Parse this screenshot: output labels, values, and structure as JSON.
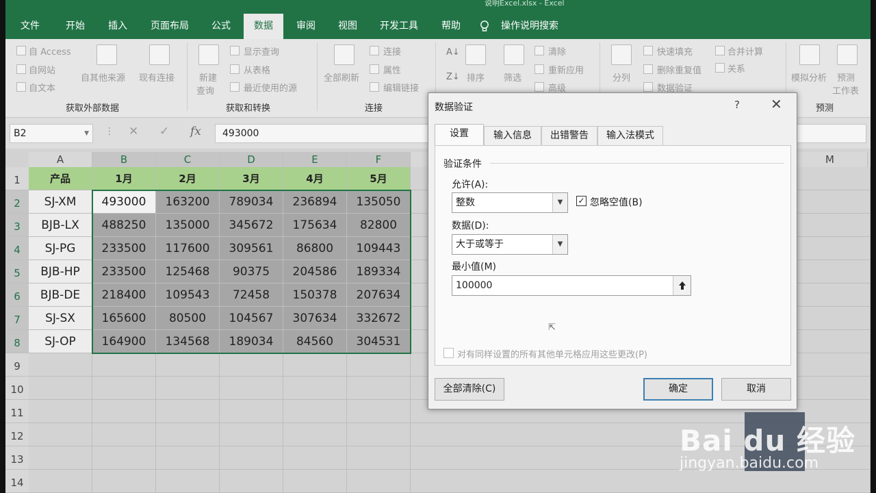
{
  "window_title": "说明Excel.xlsx - Excel",
  "ribbon": {
    "tabs": [
      "文件",
      "开始",
      "插入",
      "页面布局",
      "公式",
      "数据",
      "审阅",
      "视图",
      "开发工具",
      "帮助"
    ],
    "active_tab": "数据",
    "tell_me": "操作说明搜索",
    "groups": {
      "get_external": {
        "label": "获取外部数据",
        "items": [
          "自 Access",
          "自网站",
          "自文本",
          "自其他来源",
          "现有连接"
        ]
      },
      "get_transform": {
        "label": "获取和转换",
        "new_query": [
          "新建",
          "查询"
        ],
        "items": [
          "显示查询",
          "从表格",
          "最近使用的源"
        ]
      },
      "connections": {
        "label": "连接",
        "refresh_all": "全部刷新",
        "items": [
          "连接",
          "属性",
          "编辑链接"
        ]
      },
      "sort_filter": {
        "sort": "排序",
        "filter": "筛选",
        "items": [
          "清除",
          "重新应用",
          "高级"
        ]
      },
      "data_tools": {
        "split": "分列",
        "items": [
          "快速填充",
          "删除重复值",
          "数据验证",
          "合并计算",
          "关系"
        ]
      },
      "forecast": {
        "label": "预测",
        "what_if": "模拟分析",
        "forecast_sheet": [
          "预测",
          "工作表"
        ]
      }
    }
  },
  "formula_bar": {
    "name_box": "B2",
    "cancel": "✕",
    "confirm": "✓",
    "fx": "fx",
    "value": "493000"
  },
  "sheet": {
    "columns": [
      "A",
      "B",
      "C",
      "D",
      "E",
      "F",
      "M"
    ],
    "rows": [
      "1",
      "2",
      "3",
      "4",
      "5",
      "6",
      "7",
      "8",
      "9",
      "10",
      "11",
      "12",
      "13",
      "14"
    ],
    "header_row": [
      "产品",
      "1月",
      "2月",
      "3月",
      "4月",
      "5月"
    ],
    "data": [
      [
        "SJ-XM",
        "493000",
        "163200",
        "789034",
        "236894",
        "135050"
      ],
      [
        "BJB-LX",
        "488250",
        "135000",
        "345672",
        "175634",
        "82800"
      ],
      [
        "SJ-PG",
        "233500",
        "117600",
        "309561",
        "86800",
        "109443"
      ],
      [
        "BJB-HP",
        "233500",
        "125468",
        "90375",
        "204586",
        "189334"
      ],
      [
        "BJB-DE",
        "218400",
        "109543",
        "72458",
        "150378",
        "207634"
      ],
      [
        "SJ-SX",
        "165600",
        "80500",
        "104567",
        "307634",
        "332672"
      ],
      [
        "SJ-OP",
        "164900",
        "134568",
        "189034",
        "84560",
        "304531"
      ]
    ]
  },
  "dialog": {
    "title": "数据验证",
    "help": "?",
    "close": "✕",
    "tabs": [
      "设置",
      "输入信息",
      "出错警告",
      "输入法模式"
    ],
    "active_tab": "设置",
    "section": "验证条件",
    "allow_label": "允许(A):",
    "allow_value": "整数",
    "ignore_blank_label": "忽略空值(B)",
    "ignore_blank_checked": true,
    "data_label": "数据(D):",
    "data_value": "大于或等于",
    "min_label": "最小值(M)",
    "min_value": "100000",
    "apply_all_label": "对有同样设置的所有其他单元格应用这些更改(P)",
    "apply_all_checked": false,
    "clear_all": "全部清除(C)",
    "ok": "确定",
    "cancel": "取消"
  },
  "watermark": {
    "logo": "Bai du 经验",
    "url": "jingyan.baidu.com"
  },
  "colors": {
    "ribbon_green": "#217346",
    "header_fill": "#a9d18e",
    "selection_fill": "#a6a6a6"
  }
}
